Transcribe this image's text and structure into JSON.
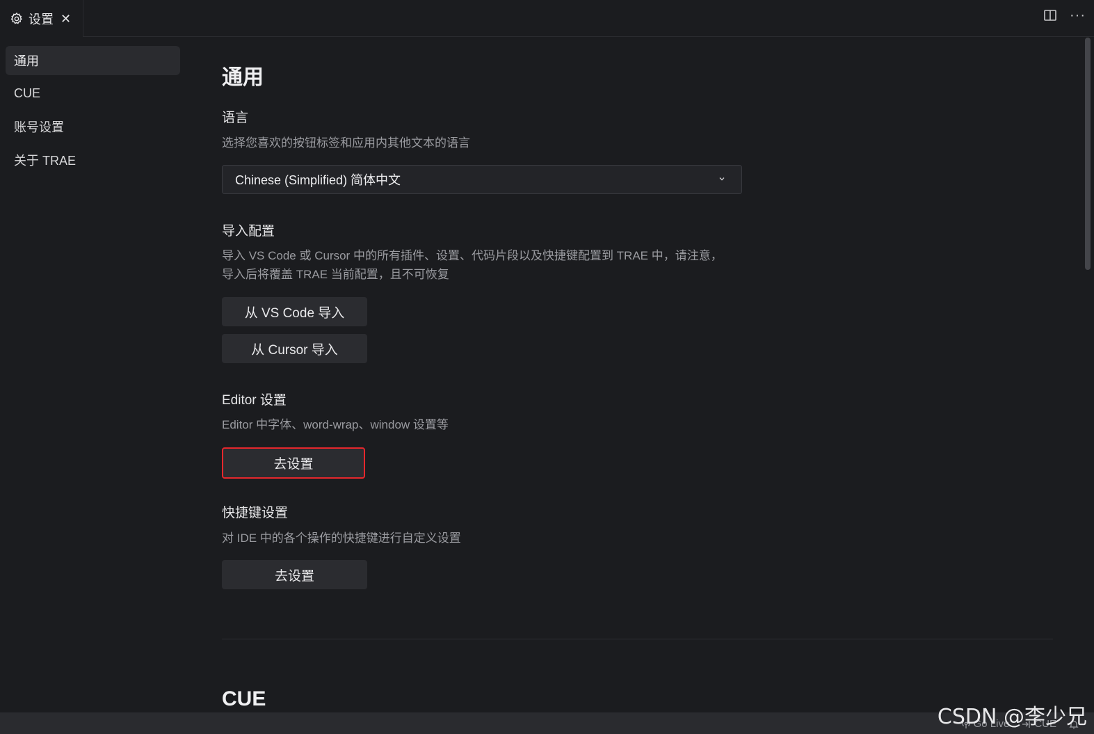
{
  "tab": {
    "label": "设置",
    "close": "✕"
  },
  "sidebar": {
    "items": [
      {
        "label": "通用",
        "active": true
      },
      {
        "label": "CUE",
        "active": false
      },
      {
        "label": "账号设置",
        "active": false
      },
      {
        "label": "关于 TRAE",
        "active": false
      }
    ]
  },
  "main": {
    "title": "通用",
    "language": {
      "title": "语言",
      "desc": "选择您喜欢的按钮标签和应用内其他文本的语言",
      "value": "Chinese (Simplified) 简体中文"
    },
    "import": {
      "title": "导入配置",
      "desc_line1": "导入 VS Code 或 Cursor 中的所有插件、设置、代码片段以及快捷键配置到 TRAE 中，请注意，",
      "desc_line2": "导入后将覆盖 TRAE 当前配置，且不可恢复",
      "vscode_btn": "从 VS Code 导入",
      "cursor_btn": "从 Cursor 导入"
    },
    "editor": {
      "title": "Editor 设置",
      "desc": "Editor 中字体、word-wrap、window 设置等",
      "btn": "去设置"
    },
    "keybindings": {
      "title": "快捷键设置",
      "desc": "对 IDE 中的各个操作的快捷键进行自定义设置",
      "btn": "去设置"
    },
    "cue_title": "CUE"
  },
  "statusbar": {
    "go_live": "Go Live",
    "cue": "CUE"
  },
  "watermark": "CSDN @李少兄",
  "colors": {
    "highlight": "#e5272c",
    "background": "#1b1c1f",
    "button": "#2b2c30"
  }
}
